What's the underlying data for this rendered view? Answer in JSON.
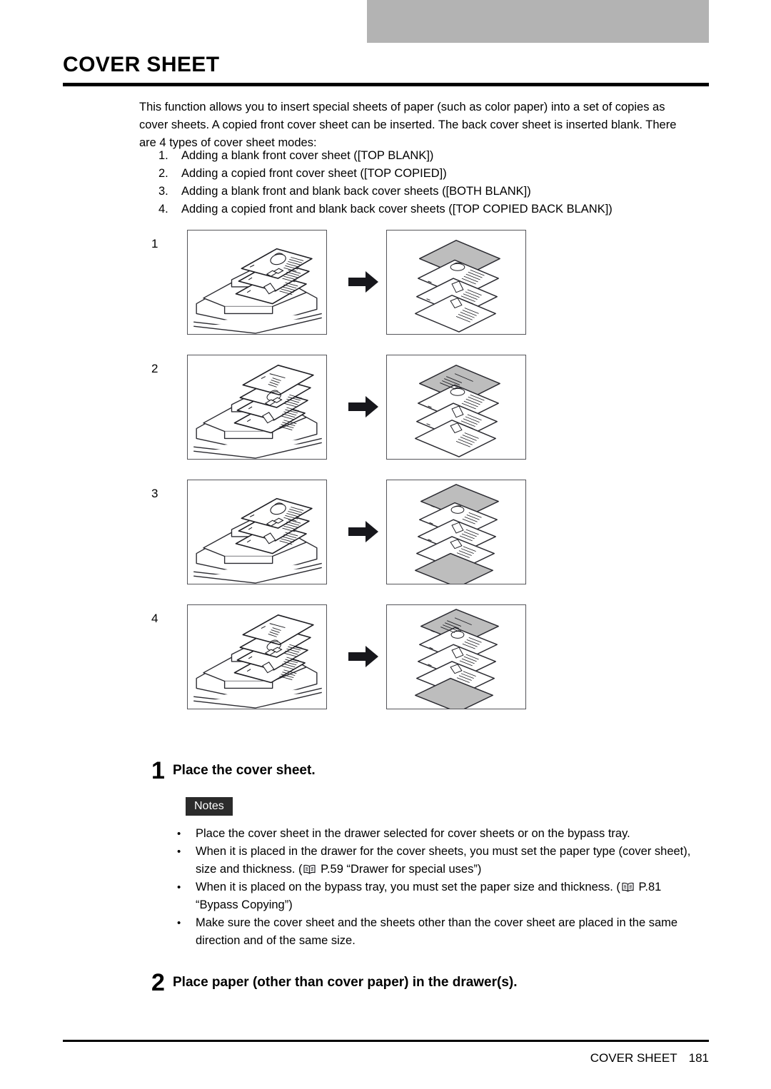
{
  "header": {
    "tab_color": "#b3b3b3"
  },
  "page_title": "COVER SHEET",
  "intro": {
    "paragraph": "This function allows you to insert special sheets of paper (such as color paper) into a set of copies as cover sheets. A copied front cover sheet can be inserted. The back cover sheet is inserted blank. There are 4 types of cover sheet modes:"
  },
  "modes": [
    {
      "num": "1.",
      "text": "Adding a blank front cover sheet ([TOP BLANK])"
    },
    {
      "num": "2.",
      "text": "Adding a copied front cover sheet ([TOP COPIED])"
    },
    {
      "num": "3.",
      "text": "Adding a blank front and blank back cover sheets ([BOTH BLANK])"
    },
    {
      "num": "4.",
      "text": "Adding a copied front and blank back cover sheets ([TOP COPIED BACK BLANK])"
    }
  ],
  "figures": [
    {
      "index": "1",
      "left_caption": "adf-with-originals",
      "right_caption": "output-stack-blank-front-cover"
    },
    {
      "index": "2",
      "left_caption": "adf-with-cover-original",
      "right_caption": "output-stack-copied-front-cover"
    },
    {
      "index": "3",
      "left_caption": "adf-with-originals",
      "right_caption": "output-stack-blank-front-and-back-covers"
    },
    {
      "index": "4",
      "left_caption": "adf-with-cover-original",
      "right_caption": "output-stack-copied-front-blank-back"
    }
  ],
  "steps": [
    {
      "num": "1",
      "title": "Place the cover sheet."
    },
    {
      "num": "2",
      "title": "Place paper (other than cover paper) in the drawer(s)."
    }
  ],
  "notes": {
    "badge": "Notes",
    "badge_color": "#2b2b2b",
    "bullet": "•",
    "items": [
      {
        "parts": [
          {
            "type": "text",
            "value": "Place the cover sheet in the drawer selected for cover sheets or on the bypass tray."
          }
        ]
      },
      {
        "parts": [
          {
            "type": "text",
            "value": "When it is placed in the drawer for the cover sheets, you must set the paper type (cover sheet), size and thickness. ("
          },
          {
            "type": "icon",
            "value": "book-icon"
          },
          {
            "type": "text",
            "value": " P.59 “Drawer for special uses”)"
          }
        ]
      },
      {
        "parts": [
          {
            "type": "text",
            "value": "When it is placed on the bypass tray, you must set the paper size and thickness. ("
          },
          {
            "type": "icon",
            "value": "book-icon"
          },
          {
            "type": "text",
            "value": " P.81 “Bypass Copying”)"
          }
        ]
      },
      {
        "parts": [
          {
            "type": "text",
            "value": "Make sure the cover sheet and the sheets other than the cover sheet are placed in the same direction and of the same size."
          }
        ]
      }
    ]
  },
  "footer": {
    "chapter": "COVER SHEET",
    "page_number": "181"
  }
}
